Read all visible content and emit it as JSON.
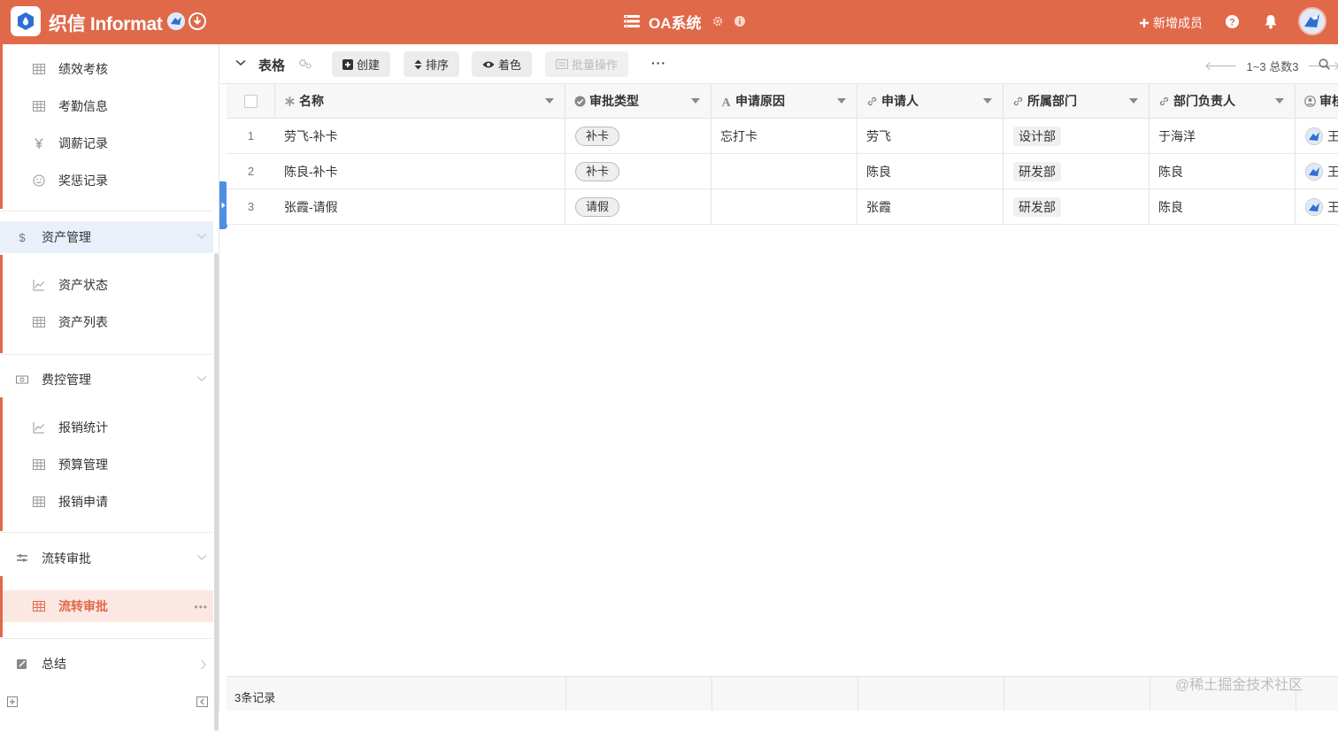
{
  "topbar": {
    "brand": "织信 Informat",
    "app_title": "OA系统",
    "add_member": "新增成员"
  },
  "sidebar": {
    "group1": [
      {
        "label": "绩效考核",
        "icon": "table-icon"
      },
      {
        "label": "考勤信息",
        "icon": "table-icon"
      },
      {
        "label": "调薪记录",
        "icon": "yen-icon"
      },
      {
        "label": "奖惩记录",
        "icon": "smile-icon"
      }
    ],
    "sections": [
      {
        "label": "资产管理",
        "icon": "dollar-icon"
      },
      {
        "label": "费控管理",
        "icon": "cash-icon"
      },
      {
        "label": "流转审批",
        "icon": "filter-icon"
      },
      {
        "label": "总结",
        "icon": "edit-icon"
      }
    ],
    "asset_items": [
      {
        "label": "资产状态",
        "icon": "chart-icon"
      },
      {
        "label": "资产列表",
        "icon": "table-icon"
      }
    ],
    "cost_items": [
      {
        "label": "报销统计",
        "icon": "chart-icon"
      },
      {
        "label": "预算管理",
        "icon": "table-icon"
      },
      {
        "label": "报销申请",
        "icon": "table-icon"
      }
    ],
    "flow_items": [
      {
        "label": "流转审批",
        "icon": "table-icon",
        "active": true
      }
    ]
  },
  "toolbar": {
    "view_name": "表格",
    "create": "创建",
    "sort": "排序",
    "color": "着色",
    "batch": "批量操作",
    "more": "···",
    "pager": "1~3 总数3"
  },
  "table": {
    "columns": [
      "名称",
      "审批类型",
      "申请原因",
      "申请人",
      "所属部门",
      "部门负责人",
      "审核"
    ],
    "rows": [
      {
        "num": "1",
        "name": "劳飞-补卡",
        "type": "补卡",
        "reason": "忘打卡",
        "applicant": "劳飞",
        "dept": "设计部",
        "leader": "于海洋",
        "auditor": "王"
      },
      {
        "num": "2",
        "name": "陈良-补卡",
        "type": "补卡",
        "reason": "",
        "applicant": "陈良",
        "dept": "研发部",
        "leader": "陈良",
        "auditor": "王"
      },
      {
        "num": "3",
        "name": "张霞-请假",
        "type": "请假",
        "reason": "",
        "applicant": "张霞",
        "dept": "研发部",
        "leader": "陈良",
        "auditor": "王"
      }
    ],
    "footer_count": "3条记录"
  },
  "watermark": "@稀土掘金技术社区",
  "colors": {
    "accent": "#e0694a",
    "blue": "#4e8fe6"
  }
}
